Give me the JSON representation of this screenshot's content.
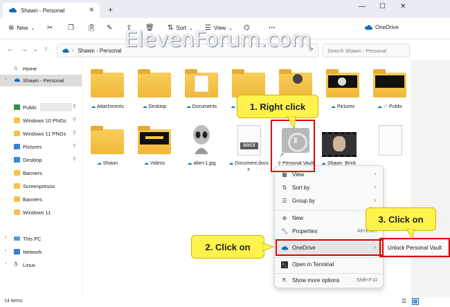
{
  "tab": {
    "title": "Shawn - Personal"
  },
  "toolbar": {
    "new_label": "New",
    "sort_label": "Sort",
    "view_label": "View",
    "more_label": "···",
    "onedrive_label": "OneDrive"
  },
  "address": {
    "path": "Shawn - Personal",
    "search_placeholder": "Search Shawn - Personal"
  },
  "watermark": "ElevenForum.com",
  "nav": [
    {
      "label": "Home",
      "type": "home"
    },
    {
      "label": "Shawn - Personal",
      "type": "cloud"
    },
    {
      "label": "Public",
      "type": "public",
      "pinned": true
    },
    {
      "label": "Windows 10 PNGs",
      "type": "folder",
      "pinned": true
    },
    {
      "label": "Windows 11 PNGs",
      "type": "folder",
      "pinned": true
    },
    {
      "label": "Pictures",
      "type": "pictures",
      "pinned": true
    },
    {
      "label": "Desktop",
      "type": "desktop",
      "pinned": true
    },
    {
      "label": "Banners",
      "type": "folder"
    },
    {
      "label": "Screenpresso",
      "type": "folder"
    },
    {
      "label": "Banners",
      "type": "folder"
    },
    {
      "label": "Windows 11",
      "type": "folder"
    },
    {
      "label": "This PC",
      "type": "pc"
    },
    {
      "label": "Network",
      "type": "network"
    },
    {
      "label": "Linux",
      "type": "linux"
    }
  ],
  "files": [
    {
      "name": "Attachments",
      "kind": "folder"
    },
    {
      "name": "Desktop",
      "kind": "folder"
    },
    {
      "name": "Documents",
      "kind": "folder-doc"
    },
    {
      "name": "M",
      "kind": "folder"
    },
    {
      "name": "",
      "kind": "folder-img"
    },
    {
      "name": "Pictures",
      "kind": "folder-dark"
    },
    {
      "name": "Public",
      "kind": "folder-dark"
    },
    {
      "name": "Shawn",
      "kind": "folder"
    },
    {
      "name": "Videos",
      "kind": "folder-dark"
    },
    {
      "name": "alien-1.jpg",
      "kind": "alien"
    },
    {
      "name": "Document.docx",
      "kind": "docx"
    },
    {
      "name": "Personal Vault",
      "kind": "vault"
    },
    {
      "name": "Shawn_Brink",
      "kind": "video"
    },
    {
      "name": "",
      "kind": "blank"
    }
  ],
  "docx_badge": "DOCX",
  "docx_extra": "x",
  "context_menu": {
    "view": "View",
    "sort_by": "Sort by",
    "group_by": "Group by",
    "new": "New",
    "properties": "Properties",
    "properties_shortcut": "Alt+Enter",
    "onedrive": "OneDrive",
    "open_terminal": "Open in Terminal",
    "show_more": "Show more options",
    "show_more_shortcut": "Shift+F10"
  },
  "submenu": {
    "unlock": "Unlock Personal Vault"
  },
  "callouts": {
    "one": "1. Right click",
    "two": "2. Click on",
    "three": "3. Click on"
  },
  "status": {
    "count": "14 items"
  },
  "colors": {
    "callout": "#fff24c",
    "highlight": "#e00000",
    "folder": "#f6c244"
  }
}
